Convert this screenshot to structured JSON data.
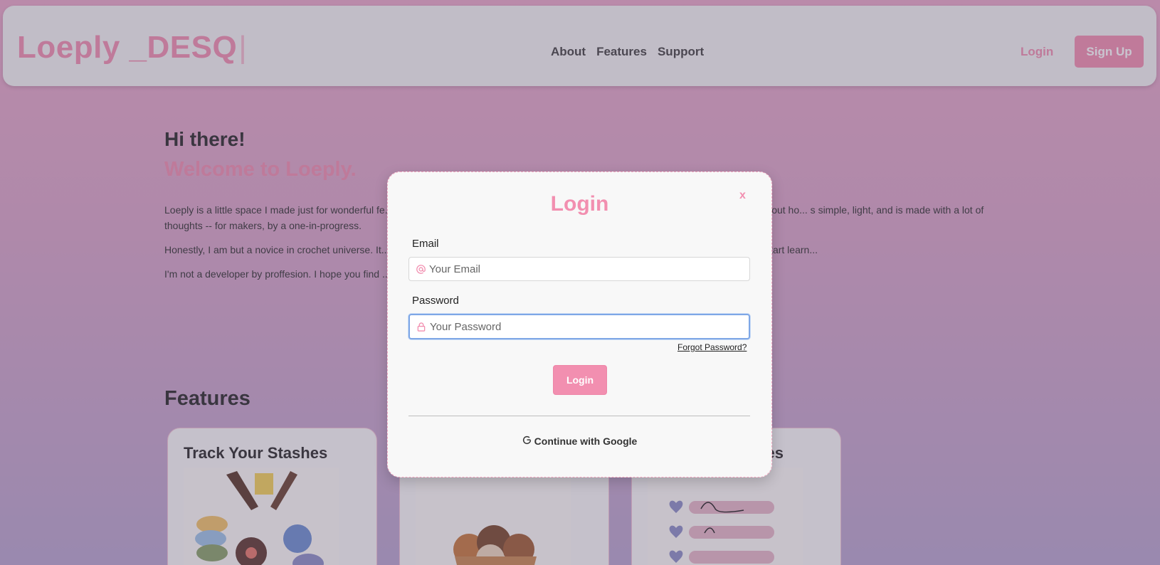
{
  "header": {
    "brand": "Loeply _DESQ",
    "brand_caret": "|",
    "nav": [
      "About",
      "Features",
      "Support"
    ],
    "login_label": "Login",
    "signup_label": "Sign Up"
  },
  "hero": {
    "greeting": "Hi there!",
    "welcome": "Welcome to Loeply.",
    "paragraphs": [
      "Loeply is a little space I made just for wonderful fe... x of stashes (God knows how much we've horded!), and for making it easier to figure out ho... s simple, light, and is made with a lot of thoughts -- for makers, by a one-in-progress.",
      "Honestly, I am but a novice in crochet universe. It... been such an overwhelming yet joyful hobby! Sometimes, I do wonder when I would start learn...",
      "I'm not a developer by proffesion. I hope you find ... hesitate to reach out."
    ]
  },
  "features": {
    "title": "Features",
    "cards": [
      "Track Your Stashes",
      "",
      "es"
    ]
  },
  "modal": {
    "title": "Login",
    "close_label": "x",
    "email_label": "Email",
    "email_placeholder": "Your Email",
    "password_label": "Password",
    "password_placeholder": "Your Password",
    "forgot_label": "Forgot Password?",
    "login_button": "Login",
    "google_label": "Continue with Google"
  },
  "colors": {
    "accent": "#f28fb0",
    "focus": "#7ea7e6"
  }
}
